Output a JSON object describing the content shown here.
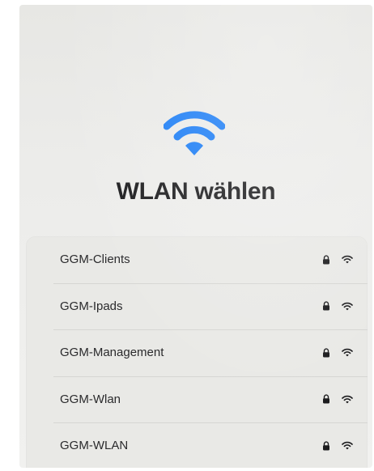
{
  "title": "WLAN wählen",
  "colors": {
    "accent": "#1a7cf5",
    "background": "#ececea",
    "list_background": "#e9e9e6",
    "text": "#1c1c1e"
  },
  "icons": {
    "hero": "wifi-icon",
    "secured": "lock-icon",
    "signal": "wifi-signal-icon"
  },
  "networks": [
    {
      "name": "GGM-Clients",
      "secured": true
    },
    {
      "name": "GGM-Ipads",
      "secured": true
    },
    {
      "name": "GGM-Management",
      "secured": true
    },
    {
      "name": "GGM-Wlan",
      "secured": true
    },
    {
      "name": "GGM-WLAN",
      "secured": true
    }
  ]
}
